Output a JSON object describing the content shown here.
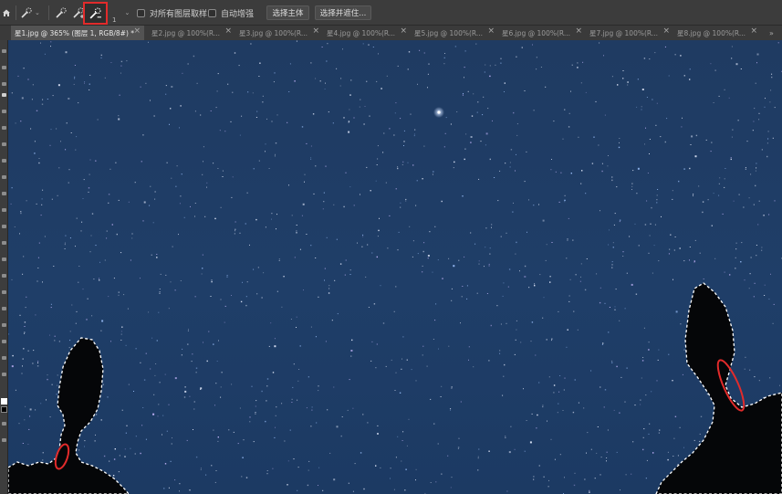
{
  "options_bar": {
    "auto_enhance_label": "自动增强",
    "sample_all_layers_label": "对所有图层取样",
    "select_subject_label": "选择主体",
    "select_and_mask_label": "选择并遮住...",
    "brush_size": "1"
  },
  "tabs": [
    {
      "label": "星1.jpg @ 365% (图层 1, RGB/8#) *",
      "active": true
    },
    {
      "label": "星2.jpg @ 100%(R...",
      "active": false
    },
    {
      "label": "星3.jpg @ 100%(R...",
      "active": false
    },
    {
      "label": "星4.jpg @ 100%(R...",
      "active": false
    },
    {
      "label": "星5.jpg @ 100%(R...",
      "active": false
    },
    {
      "label": "星6.jpg @ 100%(R...",
      "active": false
    },
    {
      "label": "星7.jpg @ 100%(R...",
      "active": false
    },
    {
      "label": "星8.jpg @ 100%(R...",
      "active": false
    }
  ],
  "colors": {
    "ui_bg": "#3c3c3c",
    "highlight": "#e22b2b",
    "sky_top": "#1f3b62",
    "sky_bottom": "#1c3a63"
  },
  "icons": [
    "home-icon",
    "quick-selection-icon",
    "add-to-selection-icon",
    "subtract-from-selection-icon",
    "close-icon"
  ]
}
